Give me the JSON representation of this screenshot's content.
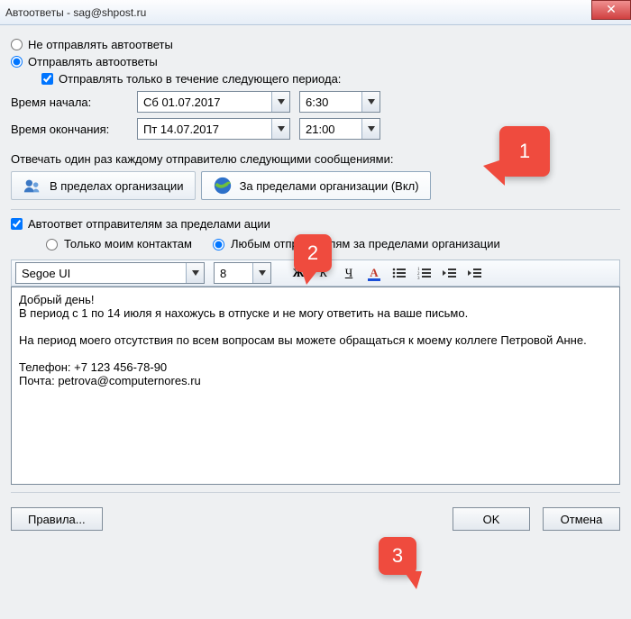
{
  "title": "Автоответы - sag@shpost.ru",
  "radios": {
    "dont_send": "Не отправлять автоответы",
    "send": "Отправлять автоответы"
  },
  "period_check": "Отправлять только в течение следующего периода:",
  "period": {
    "start_label": "Время начала:",
    "start_date": "Сб 01.07.2017",
    "start_time": "6:30",
    "end_label": "Время окончания:",
    "end_date": "Пт 14.07.2017",
    "end_time": "21:00"
  },
  "reply_text": "Отвечать один раз каждому отправителю следующими сообщениями:",
  "tabs": {
    "inside": "В пределах организации",
    "outside": "За пределами организации (Вкл)"
  },
  "outside_check": "Автоответ отправителям за пределами                    ации",
  "sub_radios": {
    "contacts_only": "Только моим контактам",
    "anyone": "Любым отправителям за пределами организации"
  },
  "toolbar": {
    "font": "Segoe UI",
    "size": "8",
    "bold": "Ж",
    "italic": "К",
    "underline": "Ч",
    "color": "А"
  },
  "message_body": "Добрый день!\nВ период с 1 по 14 июля я нахожусь в отпуске и не могу ответить на ваше письмо.\n\nНа период моего отсутствия по всем вопросам вы можете обращаться к моему коллеге Петровой Анне.\n\nТелефон: +7 123 456-78-90\nПочта: petrova@computernores.ru",
  "buttons": {
    "rules": "Правила...",
    "ok": "OK",
    "cancel": "Отмена"
  },
  "callouts": {
    "one": "1",
    "two": "2",
    "three": "3"
  }
}
